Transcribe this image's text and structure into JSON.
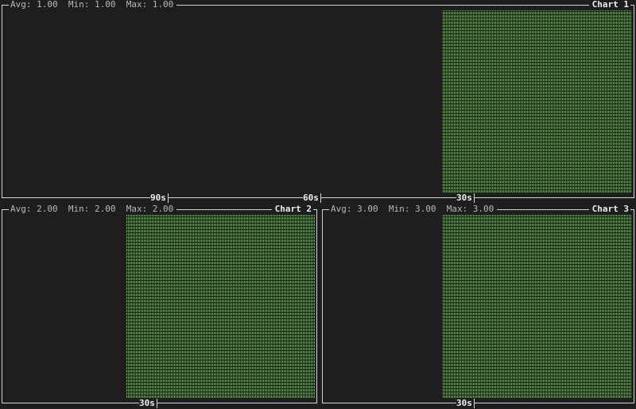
{
  "colors": {
    "background": "#1e1e1e",
    "border": "#d6d6d6",
    "bar_fill": "#5fb839",
    "stats_text": "#b9b9b9",
    "title_text": "#ededed"
  },
  "charts": [
    {
      "title": "Chart 1",
      "stats": "Avg: 1.00  Min: 1.00  Max: 1.00",
      "ticks": [
        "90s",
        "60s",
        "30s"
      ]
    },
    {
      "title": "Chart 2",
      "stats": "Avg: 2.00  Min: 2.00  Max: 2.00",
      "ticks": [
        "30s"
      ]
    },
    {
      "title": "Chart 3",
      "stats": "Avg: 3.00  Min: 3.00  Max: 3.00",
      "ticks": [
        "30s"
      ]
    }
  ]
}
